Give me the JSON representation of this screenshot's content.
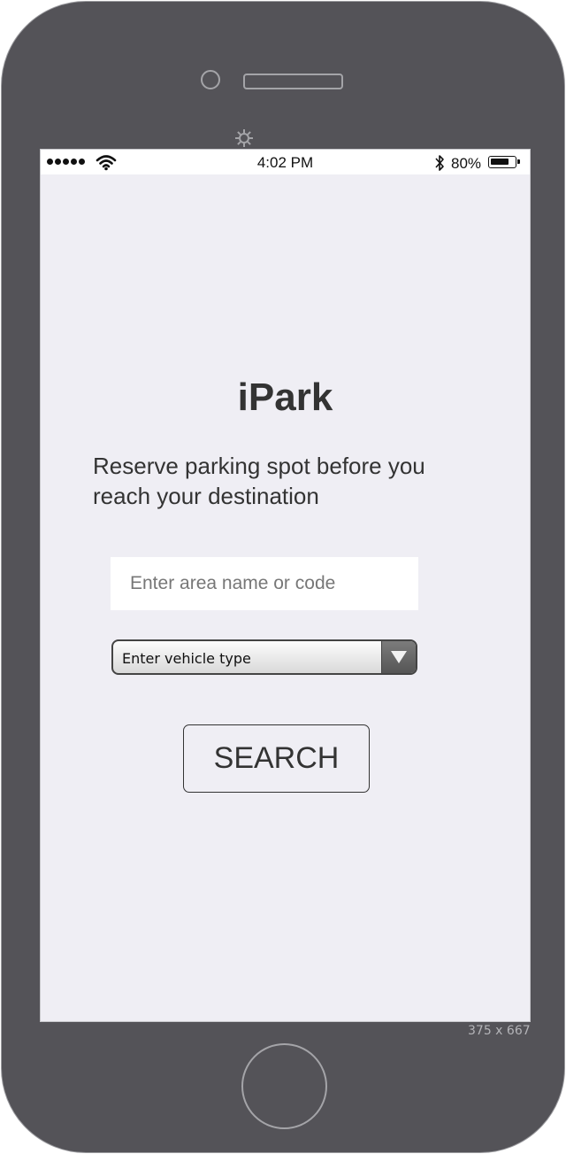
{
  "status_bar": {
    "time": "4:02 PM",
    "battery_percent": "80%",
    "battery_level": 0.8,
    "signal_dots": 5
  },
  "app": {
    "title": "iPark",
    "tagline": "Reserve parking spot before you reach your destination"
  },
  "form": {
    "area_placeholder": "Enter area name or code",
    "area_value": "",
    "vehicle_type_selected": "Enter vehicle type",
    "search_label": "SEARCH"
  },
  "device": {
    "dimensions_label": "375 x 667"
  },
  "colors": {
    "device_frame": "#545358",
    "screen_background": "#efeef4",
    "text": "#333333"
  }
}
